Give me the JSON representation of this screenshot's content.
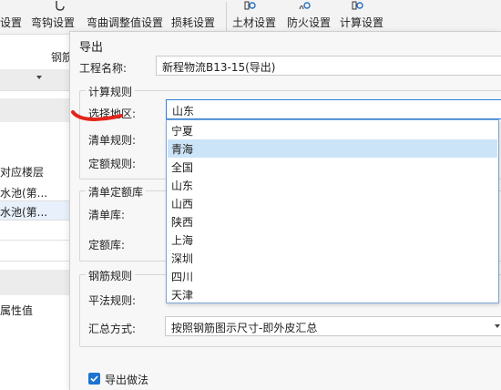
{
  "ribbon": {
    "items": [
      {
        "label": "设置"
      },
      {
        "label": "弯钩设置"
      },
      {
        "label": "弯曲调整值设置"
      },
      {
        "label": "损耗设置"
      },
      {
        "label": "土材设置"
      },
      {
        "label": "防火设置"
      },
      {
        "label": "计算设置"
      }
    ],
    "sub_label": "钢筋"
  },
  "background": {
    "col_header": "对应楼层",
    "row1": "水池(第...",
    "row2": "水池(第...",
    "prop_header": "属性值"
  },
  "dialog": {
    "title": "导出",
    "project_label": "工程名称:",
    "project_value": "新程物流B13-15(导出)",
    "calc_group": {
      "title": "计算规则",
      "region_label": "选择地区:",
      "region_value": "山东",
      "bill_rule_label": "清单规则:",
      "quota_rule_label": "定额规则:"
    },
    "lib_group": {
      "title": "清单定额库",
      "bill_lib_label": "清单库:",
      "quota_lib_label": "定额库:"
    },
    "rebar_group": {
      "title": "钢筋规则",
      "flat_rule_label": "平法规则:",
      "summary_label": "汇总方式:",
      "summary_value": "按照钢筋图示尺寸-即外皮汇总"
    },
    "export_checkbox": {
      "label": "导出做法",
      "checked": true
    },
    "region_options": [
      "宁夏",
      "青海",
      "全国",
      "山东",
      "山西",
      "陕西",
      "上海",
      "深圳",
      "四川",
      "天津"
    ],
    "highlighted_option": "青海"
  },
  "colors": {
    "accent": "#1e74d0",
    "selection": "#cce4f7",
    "annotation": "#e2261c"
  }
}
